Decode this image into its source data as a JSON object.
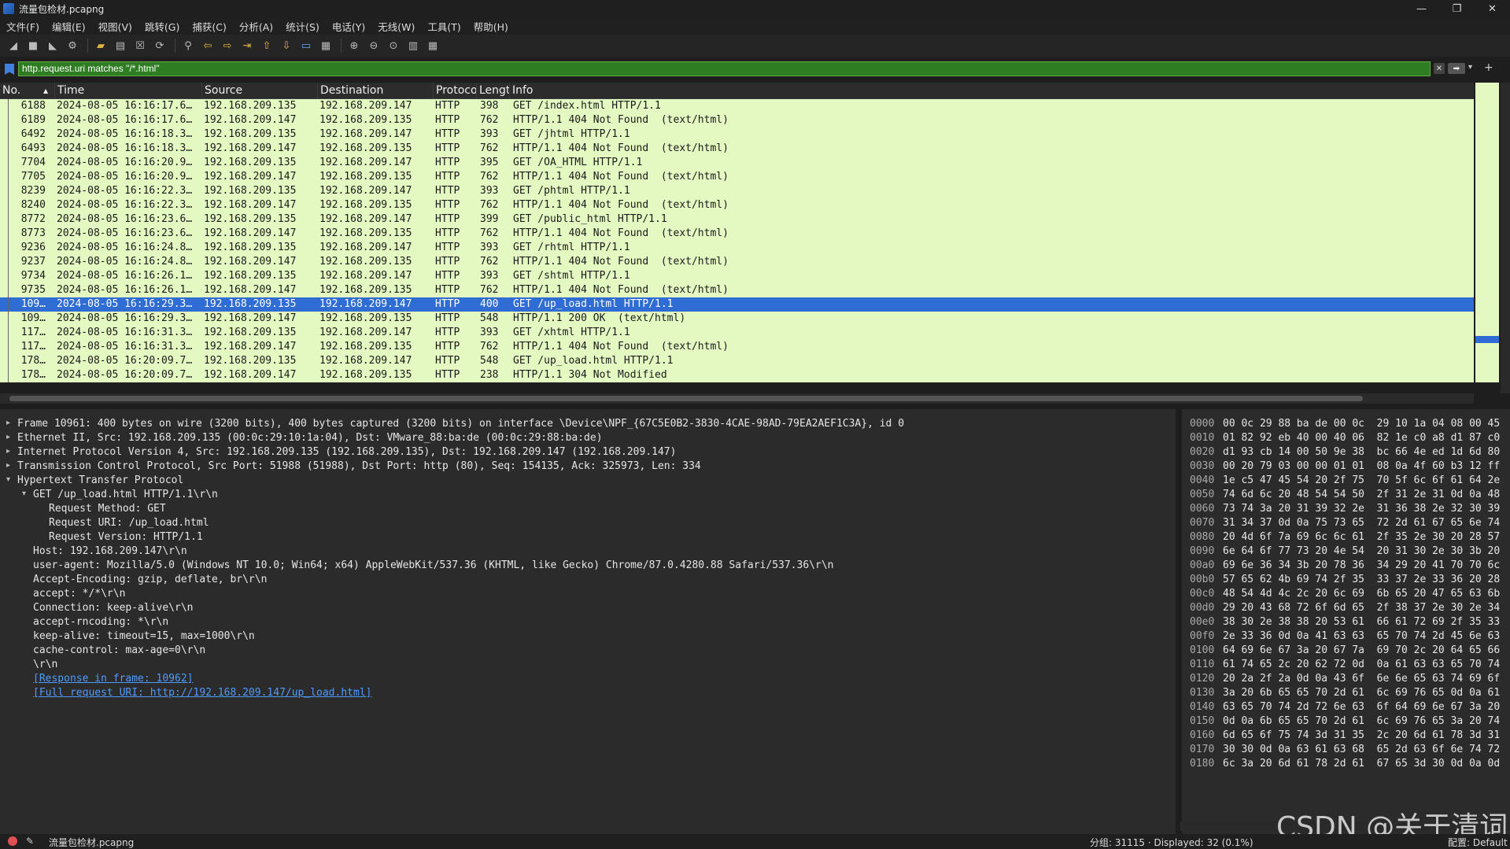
{
  "window": {
    "title": "流量包检材.pcapng",
    "controls": [
      "—",
      "❐",
      "✕"
    ]
  },
  "menu": [
    "文件(F)",
    "编辑(E)",
    "视图(V)",
    "跳转(G)",
    "捕获(C)",
    "分析(A)",
    "统计(S)",
    "电话(Y)",
    "无线(W)",
    "工具(T)",
    "帮助(H)"
  ],
  "filter": {
    "value": "http.request.uri matches \"/*.html\"",
    "clear_label": "✕",
    "apply_label": "➡",
    "dropdown_label": "▾",
    "add_label": "+"
  },
  "columns": [
    "No.",
    "Time",
    "Source",
    "Destination",
    "Protocol",
    "Length",
    "Info"
  ],
  "packets": [
    {
      "no": "6188",
      "time": "2024-08-05 16:16:17.6…",
      "src": "192.168.209.135",
      "dst": "192.168.209.147",
      "proto": "HTTP",
      "len": "398",
      "info": "GET /index.html HTTP/1.1"
    },
    {
      "no": "6189",
      "time": "2024-08-05 16:16:17.6…",
      "src": "192.168.209.147",
      "dst": "192.168.209.135",
      "proto": "HTTP",
      "len": "762",
      "info": "HTTP/1.1 404 Not Found  (text/html)"
    },
    {
      "no": "6492",
      "time": "2024-08-05 16:16:18.3…",
      "src": "192.168.209.135",
      "dst": "192.168.209.147",
      "proto": "HTTP",
      "len": "393",
      "info": "GET /jhtml HTTP/1.1"
    },
    {
      "no": "6493",
      "time": "2024-08-05 16:16:18.3…",
      "src": "192.168.209.147",
      "dst": "192.168.209.135",
      "proto": "HTTP",
      "len": "762",
      "info": "HTTP/1.1 404 Not Found  (text/html)"
    },
    {
      "no": "7704",
      "time": "2024-08-05 16:16:20.9…",
      "src": "192.168.209.135",
      "dst": "192.168.209.147",
      "proto": "HTTP",
      "len": "395",
      "info": "GET /OA_HTML HTTP/1.1"
    },
    {
      "no": "7705",
      "time": "2024-08-05 16:16:20.9…",
      "src": "192.168.209.147",
      "dst": "192.168.209.135",
      "proto": "HTTP",
      "len": "762",
      "info": "HTTP/1.1 404 Not Found  (text/html)"
    },
    {
      "no": "8239",
      "time": "2024-08-05 16:16:22.3…",
      "src": "192.168.209.135",
      "dst": "192.168.209.147",
      "proto": "HTTP",
      "len": "393",
      "info": "GET /phtml HTTP/1.1"
    },
    {
      "no": "8240",
      "time": "2024-08-05 16:16:22.3…",
      "src": "192.168.209.147",
      "dst": "192.168.209.135",
      "proto": "HTTP",
      "len": "762",
      "info": "HTTP/1.1 404 Not Found  (text/html)"
    },
    {
      "no": "8772",
      "time": "2024-08-05 16:16:23.6…",
      "src": "192.168.209.135",
      "dst": "192.168.209.147",
      "proto": "HTTP",
      "len": "399",
      "info": "GET /public_html HTTP/1.1"
    },
    {
      "no": "8773",
      "time": "2024-08-05 16:16:23.6…",
      "src": "192.168.209.147",
      "dst": "192.168.209.135",
      "proto": "HTTP",
      "len": "762",
      "info": "HTTP/1.1 404 Not Found  (text/html)"
    },
    {
      "no": "9236",
      "time": "2024-08-05 16:16:24.8…",
      "src": "192.168.209.135",
      "dst": "192.168.209.147",
      "proto": "HTTP",
      "len": "393",
      "info": "GET /rhtml HTTP/1.1"
    },
    {
      "no": "9237",
      "time": "2024-08-05 16:16:24.8…",
      "src": "192.168.209.147",
      "dst": "192.168.209.135",
      "proto": "HTTP",
      "len": "762",
      "info": "HTTP/1.1 404 Not Found  (text/html)"
    },
    {
      "no": "9734",
      "time": "2024-08-05 16:16:26.1…",
      "src": "192.168.209.135",
      "dst": "192.168.209.147",
      "proto": "HTTP",
      "len": "393",
      "info": "GET /shtml HTTP/1.1"
    },
    {
      "no": "9735",
      "time": "2024-08-05 16:16:26.1…",
      "src": "192.168.209.147",
      "dst": "192.168.209.135",
      "proto": "HTTP",
      "len": "762",
      "info": "HTTP/1.1 404 Not Found  (text/html)"
    },
    {
      "no": "109…",
      "time": "2024-08-05 16:16:29.3…",
      "src": "192.168.209.135",
      "dst": "192.168.209.147",
      "proto": "HTTP",
      "len": "400",
      "info": "GET /up_load.html HTTP/1.1",
      "selected": true
    },
    {
      "no": "109…",
      "time": "2024-08-05 16:16:29.3…",
      "src": "192.168.209.147",
      "dst": "192.168.209.135",
      "proto": "HTTP",
      "len": "548",
      "info": "HTTP/1.1 200 OK  (text/html)"
    },
    {
      "no": "117…",
      "time": "2024-08-05 16:16:31.3…",
      "src": "192.168.209.135",
      "dst": "192.168.209.147",
      "proto": "HTTP",
      "len": "393",
      "info": "GET /xhtml HTTP/1.1"
    },
    {
      "no": "117…",
      "time": "2024-08-05 16:16:31.3…",
      "src": "192.168.209.147",
      "dst": "192.168.209.135",
      "proto": "HTTP",
      "len": "762",
      "info": "HTTP/1.1 404 Not Found  (text/html)"
    },
    {
      "no": "178…",
      "time": "2024-08-05 16:20:09.7…",
      "src": "192.168.209.135",
      "dst": "192.168.209.147",
      "proto": "HTTP",
      "len": "548",
      "info": "GET /up_load.html HTTP/1.1"
    },
    {
      "no": "178…",
      "time": "2024-08-05 16:20:09.7…",
      "src": "192.168.209.147",
      "dst": "192.168.209.135",
      "proto": "HTTP",
      "len": "238",
      "info": "HTTP/1.1 304 Not Modified"
    }
  ],
  "details": [
    {
      "indent": 0,
      "arrow": "▸",
      "text": "Frame 10961: 400 bytes on wire (3200 bits), 400 bytes captured (3200 bits) on interface \\Device\\NPF_{67C5E0B2-3830-4CAE-98AD-79EA2AEF1C3A}, id 0"
    },
    {
      "indent": 0,
      "arrow": "▸",
      "text": "Ethernet II, Src: 192.168.209.135 (00:0c:29:10:1a:04), Dst: VMware_88:ba:de (00:0c:29:88:ba:de)"
    },
    {
      "indent": 0,
      "arrow": "▸",
      "text": "Internet Protocol Version 4, Src: 192.168.209.135 (192.168.209.135), Dst: 192.168.209.147 (192.168.209.147)"
    },
    {
      "indent": 0,
      "arrow": "▸",
      "text": "Transmission Control Protocol, Src Port: 51988 (51988), Dst Port: http (80), Seq: 154135, Ack: 325973, Len: 334"
    },
    {
      "indent": 0,
      "arrow": "▾",
      "text": "Hypertext Transfer Protocol"
    },
    {
      "indent": 1,
      "arrow": "▾",
      "text": "GET /up_load.html HTTP/1.1\\r\\n"
    },
    {
      "indent": 2,
      "arrow": "",
      "text": "Request Method: GET"
    },
    {
      "indent": 2,
      "arrow": "",
      "text": "Request URI: /up_load.html"
    },
    {
      "indent": 2,
      "arrow": "",
      "text": "Request Version: HTTP/1.1"
    },
    {
      "indent": 1,
      "arrow": "",
      "text": "Host: 192.168.209.147\\r\\n"
    },
    {
      "indent": 1,
      "arrow": "",
      "text": "user-agent: Mozilla/5.0 (Windows NT 10.0; Win64; x64) AppleWebKit/537.36 (KHTML, like Gecko) Chrome/87.0.4280.88 Safari/537.36\\r\\n"
    },
    {
      "indent": 1,
      "arrow": "",
      "text": "Accept-Encoding: gzip, deflate, br\\r\\n"
    },
    {
      "indent": 1,
      "arrow": "",
      "text": "accept: */*\\r\\n"
    },
    {
      "indent": 1,
      "arrow": "",
      "text": "Connection: keep-alive\\r\\n"
    },
    {
      "indent": 1,
      "arrow": "",
      "text": "accept-rncoding: *\\r\\n"
    },
    {
      "indent": 1,
      "arrow": "",
      "text": "keep-alive: timeout=15, max=1000\\r\\n"
    },
    {
      "indent": 1,
      "arrow": "",
      "text": "cache-control: max-age=0\\r\\n"
    },
    {
      "indent": 1,
      "arrow": "",
      "text": "\\r\\n"
    },
    {
      "indent": 1,
      "arrow": "",
      "text": "[Response in frame: 10962]",
      "link": true
    },
    {
      "indent": 1,
      "arrow": "",
      "text": "[Full request URI: http://192.168.209.147/up_load.html]",
      "link": true
    }
  ],
  "hex": [
    {
      "off": "0000",
      "bytes": "00 0c 29 88 ba de 00 0c  29 10 1a 04 08 00 45"
    },
    {
      "off": "0010",
      "bytes": "01 82 92 eb 40 00 40 06  82 1e c0 a8 d1 87 c0"
    },
    {
      "off": "0020",
      "bytes": "d1 93 cb 14 00 50 9e 38  bc 66 4e ed 1d 6d 80"
    },
    {
      "off": "0030",
      "bytes": "00 20 79 03 00 00 01 01  08 0a 4f 60 b3 12 ff"
    },
    {
      "off": "0040",
      "bytes": "1e c5 47 45 54 20 2f 75  70 5f 6c 6f 61 64 2e"
    },
    {
      "off": "0050",
      "bytes": "74 6d 6c 20 48 54 54 50  2f 31 2e 31 0d 0a 48"
    },
    {
      "off": "0060",
      "bytes": "73 74 3a 20 31 39 32 2e  31 36 38 2e 32 30 39"
    },
    {
      "off": "0070",
      "bytes": "31 34 37 0d 0a 75 73 65  72 2d 61 67 65 6e 74"
    },
    {
      "off": "0080",
      "bytes": "20 4d 6f 7a 69 6c 6c 61  2f 35 2e 30 20 28 57"
    },
    {
      "off": "0090",
      "bytes": "6e 64 6f 77 73 20 4e 54  20 31 30 2e 30 3b 20"
    },
    {
      "off": "00a0",
      "bytes": "69 6e 36 34 3b 20 78 36  34 29 20 41 70 70 6c"
    },
    {
      "off": "00b0",
      "bytes": "57 65 62 4b 69 74 2f 35  33 37 2e 33 36 20 28"
    },
    {
      "off": "00c0",
      "bytes": "48 54 4d 4c 2c 20 6c 69  6b 65 20 47 65 63 6b"
    },
    {
      "off": "00d0",
      "bytes": "29 20 43 68 72 6f 6d 65  2f 38 37 2e 30 2e 34"
    },
    {
      "off": "00e0",
      "bytes": "38 30 2e 38 38 20 53 61  66 61 72 69 2f 35 33"
    },
    {
      "off": "00f0",
      "bytes": "2e 33 36 0d 0a 41 63 63  65 70 74 2d 45 6e 63"
    },
    {
      "off": "0100",
      "bytes": "64 69 6e 67 3a 20 67 7a  69 70 2c 20 64 65 66"
    },
    {
      "off": "0110",
      "bytes": "61 74 65 2c 20 62 72 0d  0a 61 63 63 65 70 74"
    },
    {
      "off": "0120",
      "bytes": "20 2a 2f 2a 0d 0a 43 6f  6e 6e 65 63 74 69 6f"
    },
    {
      "off": "0130",
      "bytes": "3a 20 6b 65 65 70 2d 61  6c 69 76 65 0d 0a 61"
    },
    {
      "off": "0140",
      "bytes": "63 65 70 74 2d 72 6e 63  6f 64 69 6e 67 3a 20"
    },
    {
      "off": "0150",
      "bytes": "0d 0a 6b 65 65 70 2d 61  6c 69 76 65 3a 20 74"
    },
    {
      "off": "0160",
      "bytes": "6d 65 6f 75 74 3d 31 35  2c 20 6d 61 78 3d 31"
    },
    {
      "off": "0170",
      "bytes": "30 30 0d 0a 63 61 63 68  65 2d 63 6f 6e 74 72"
    },
    {
      "off": "0180",
      "bytes": "6c 3a 20 6d 61 78 2d 61  67 65 3d 30 0d 0a 0d"
    }
  ],
  "status": {
    "file": "流量包检材.pcapng",
    "packets": "分组: 31115 · Displayed: 32 (0.1%)",
    "profile": "配置: Default"
  },
  "watermark": "CSDN @关于清词",
  "colors": {
    "row_bg": "#e4f9c2",
    "selected_bg": "#2f6cd3",
    "filter_bg": "#2e7d22"
  }
}
